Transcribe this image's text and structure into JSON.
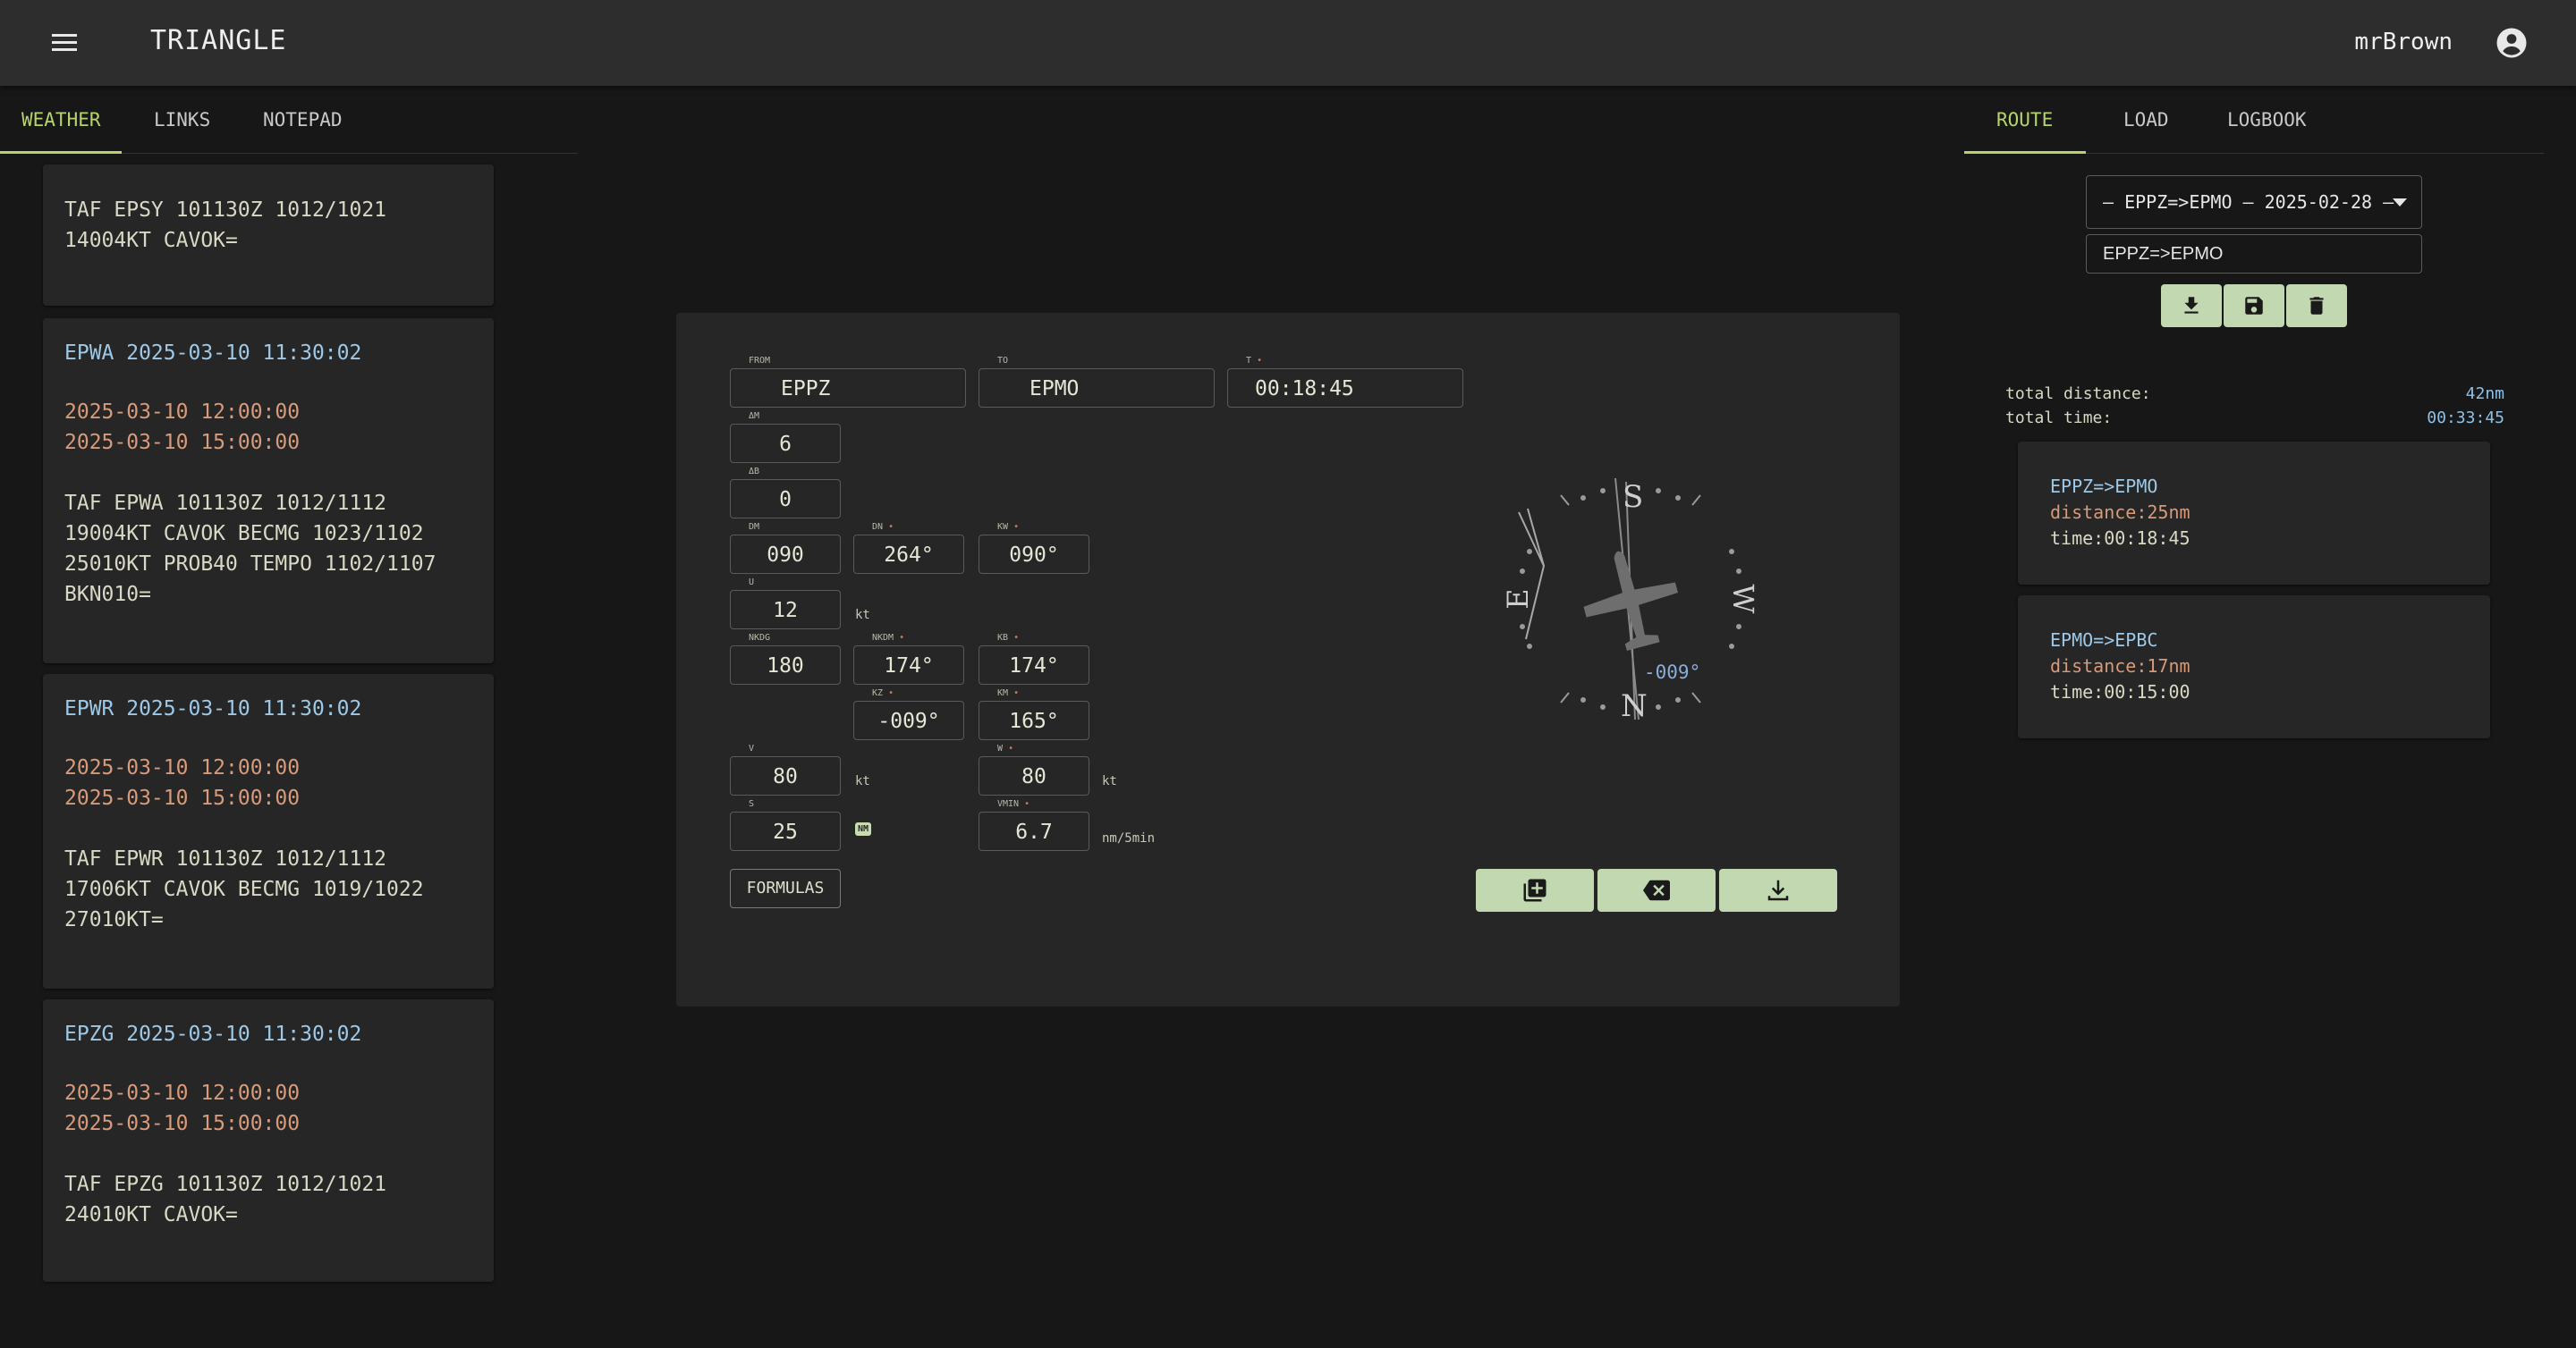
{
  "app": {
    "title": "TRIANGLE",
    "user": "mrBrown"
  },
  "left_tabs": [
    {
      "label": "WEATHER",
      "active": true
    },
    {
      "label": "LINKS",
      "active": false
    },
    {
      "label": "NOTEPAD",
      "active": false
    }
  ],
  "right_tabs": [
    {
      "label": "ROUTE",
      "active": true
    },
    {
      "label": "LOAD",
      "active": false
    },
    {
      "label": "LOGBOOK",
      "active": false
    }
  ],
  "weather": [
    {
      "station": "",
      "from": "",
      "to": "",
      "taf": "TAF EPSY 101130Z 1012/1021\n14004KT CAVOK="
    },
    {
      "station": "EPWA 2025-03-10 11:30:02",
      "from": "2025-03-10 12:00:00",
      "to": "2025-03-10 15:00:00",
      "taf": "TAF EPWA 101130Z 1012/1112\n19004KT CAVOK BECMG 1023/1102\n25010KT PROB40 TEMPO 1102/1107\nBKN010="
    },
    {
      "station": "EPWR 2025-03-10 11:30:02",
      "from": "2025-03-10 12:00:00",
      "to": "2025-03-10 15:00:00",
      "taf": "TAF EPWR 101130Z 1012/1112\n17006KT CAVOK BECMG 1019/1022\n27010KT="
    },
    {
      "station": "EPZG 2025-03-10 11:30:02",
      "from": "2025-03-10 12:00:00",
      "to": "2025-03-10 15:00:00",
      "taf": "TAF EPZG 101130Z 1012/1021\n24010KT CAVOK="
    }
  ],
  "calc": {
    "from": {
      "label": "FROM",
      "value": "EPPZ"
    },
    "to": {
      "label": "TO",
      "value": "EPMO"
    },
    "t": {
      "label": "T",
      "value": "00:18:45"
    },
    "dm": {
      "label": "ΔM",
      "value": "6"
    },
    "db": {
      "label": "ΔB",
      "value": "0"
    },
    "dmag": {
      "label": "DM",
      "value": "090"
    },
    "dn": {
      "label": "DN",
      "value": "264°"
    },
    "kw": {
      "label": "KW",
      "value": "090°"
    },
    "u": {
      "label": "U",
      "value": "12",
      "unit": "kt"
    },
    "nkdg": {
      "label": "NKDG",
      "value": "180"
    },
    "nkdm": {
      "label": "NKDM",
      "value": "174°"
    },
    "kb": {
      "label": "KB",
      "value": "174°"
    },
    "kz": {
      "label": "KZ",
      "value": "-009°"
    },
    "km": {
      "label": "KM",
      "value": "165°"
    },
    "v": {
      "label": "V",
      "value": "80",
      "unit": "kt"
    },
    "w": {
      "label": "W",
      "value": "80",
      "unit": "kt"
    },
    "s": {
      "label": "S",
      "value": "25",
      "badge": "NM"
    },
    "vmin": {
      "label": "VMIN",
      "value": "6.7",
      "unit": "nm/5min"
    },
    "formulas_label": "FORMULAS",
    "compass": {
      "n": "N",
      "s": "S",
      "e": "E",
      "w": "W",
      "deviation": "-009°"
    }
  },
  "route": {
    "selected": "– EPPZ=>EPMO – 2025-02-28 –",
    "name": "EPPZ=>EPMO",
    "total_distance_label": "total distance:",
    "total_distance": "42nm",
    "total_time_label": "total time:",
    "total_time": "00:33:45",
    "legs": [
      {
        "name": "EPPZ=>EPMO",
        "distance": "distance:25nm",
        "time": "time:00:18:45"
      },
      {
        "name": "EPMO=>EPBC",
        "distance": "distance:17nm",
        "time": "time:00:15:00"
      }
    ]
  }
}
